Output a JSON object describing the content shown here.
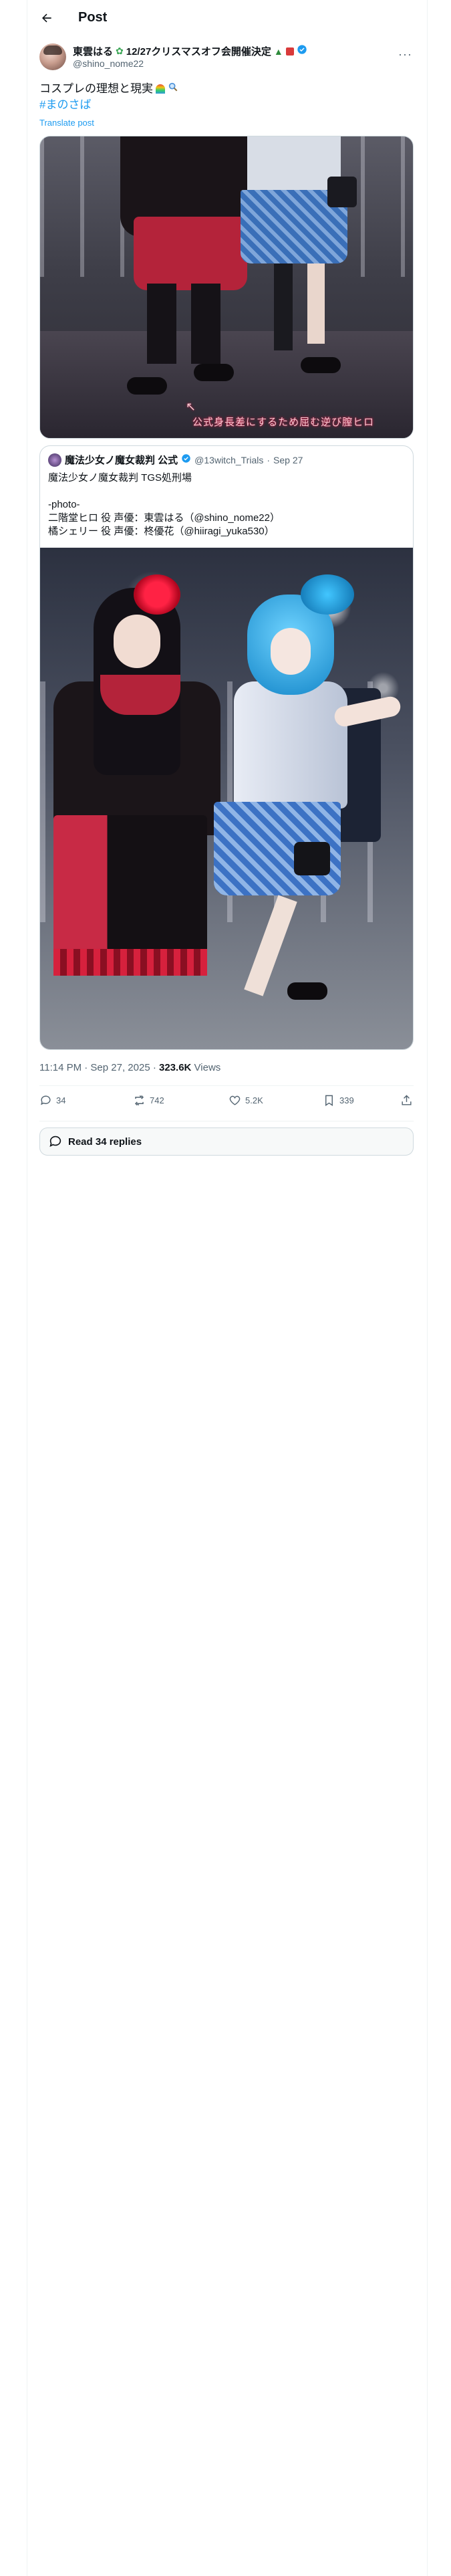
{
  "header": {
    "title": "Post"
  },
  "author": {
    "name": "東雲はる",
    "name_suffix": "12/27クリスマスオフ会開催決定",
    "handle": "@shino_nome22",
    "icons": [
      "clover-icon",
      "christmas-tree-icon",
      "gift-icon",
      "verified-badge-icon"
    ]
  },
  "post": {
    "text": "コスプレの理想と現実",
    "text_emoji": [
      "rainbow-icon",
      "magnifier-icon"
    ],
    "hashtag": "#まのさば",
    "translate_label": "Translate post",
    "media_caption": "公式身長差にするため屈む逆び膣ヒロ"
  },
  "quote": {
    "name": "魔法少女ノ魔女裁判 公式",
    "handle": "@13witch_Trials",
    "date": "Sep 27",
    "text": "魔法少女ノ魔女裁判 TGS処刑場\n\n-photo-\n二階堂ヒロ 役 声優：東雲はる（@shino_nome22）\n橘シェリー 役 声優：柊優花（@hiiragi_yuka530）"
  },
  "meta": {
    "time": "11:14 PM · Sep 27, 2025 · ",
    "views_count": "323.6K",
    "views_label": " Views"
  },
  "actions": {
    "replies": "34",
    "reposts": "742",
    "likes": "5.2K",
    "bookmarks": "339"
  },
  "read_replies": {
    "label": "Read 34 replies"
  },
  "colors": {
    "accent": "#1d9bf0",
    "muted": "#536471",
    "text": "#0f1419"
  }
}
